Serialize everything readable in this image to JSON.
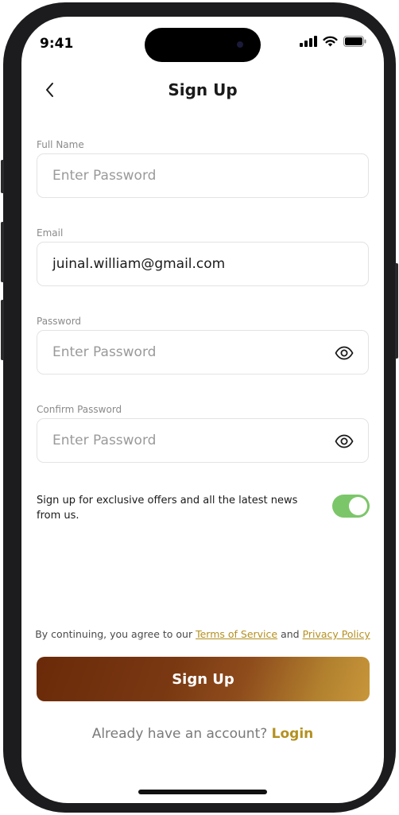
{
  "status_bar": {
    "time": "9:41"
  },
  "header": {
    "title": "Sign Up"
  },
  "form": {
    "full_name": {
      "label": "Full Name",
      "placeholder": "Enter Password",
      "value": ""
    },
    "email": {
      "label": "Email",
      "value": "juinal.william@gmail.com"
    },
    "password": {
      "label": "Password",
      "placeholder": "Enter Password"
    },
    "confirm_password": {
      "label": "Confirm Password",
      "placeholder": "Enter Password"
    }
  },
  "offers": {
    "text": "Sign up for exclusive offers and all the latest news from us.",
    "enabled": true
  },
  "terms": {
    "prefix": "By continuing, you agree to our ",
    "terms_link": "Terms of Service",
    "and": " and ",
    "privacy_link": "Privacy Policy"
  },
  "actions": {
    "signup_label": "Sign Up"
  },
  "footer": {
    "question": "Already have an account? ",
    "login_label": "Login"
  },
  "colors": {
    "accent": "#b4901f",
    "toggle_on": "#7cc66a",
    "button_start": "#6a2a09",
    "button_end": "#c8963a"
  },
  "icons": [
    "back-chevron-icon",
    "signal-icon",
    "wifi-icon",
    "battery-icon",
    "eye-icon"
  ]
}
